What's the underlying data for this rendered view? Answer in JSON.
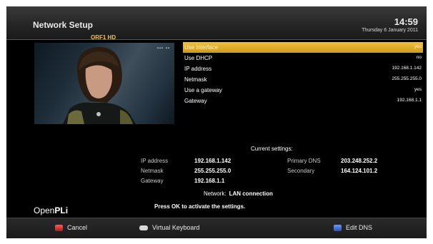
{
  "header": {
    "title": "Network Setup",
    "time": "14:59",
    "date": "Thursday  6 January 2011"
  },
  "channel": "ORF1 HD",
  "pip_indicator": "▪▪▪ ▪▪",
  "settings": [
    {
      "label": "Use interface",
      "value": "yes",
      "selected": true
    },
    {
      "label": "Use DHCP",
      "value": "no",
      "selected": false
    },
    {
      "label": "IP address",
      "value": "192.168.1.142",
      "selected": false
    },
    {
      "label": "Netmask",
      "value": "255.255.255.0",
      "selected": false
    },
    {
      "label": "Use a gateway",
      "value": "yes",
      "selected": false
    },
    {
      "label": "Gateway",
      "value": "192.168.1.1",
      "selected": false
    }
  ],
  "current": {
    "heading": "Current settings:",
    "ip_label": "IP address",
    "ip": "192.168.1.142",
    "netmask_label": "Netmask",
    "netmask": "255.255.255.0",
    "gateway_label": "Gateway",
    "gateway": "192.168.1.1",
    "dns1_label": "Primary DNS",
    "dns1": "203.248.252.2",
    "dns2_label": "Secondary",
    "dns2": "164.124.101.2"
  },
  "network_label": "Network:",
  "network_value": "LAN connection",
  "hint": "Press OK to activate the settings.",
  "logo": {
    "part1": "Open",
    "part2": "PLi"
  },
  "footer": {
    "cancel": "Cancel",
    "keyboard": "Virtual Keyboard",
    "edit_dns": "Edit DNS"
  },
  "colors": {
    "red": "#d93030",
    "blue": "#3a6fe0",
    "highlight": "#e0aa28"
  }
}
